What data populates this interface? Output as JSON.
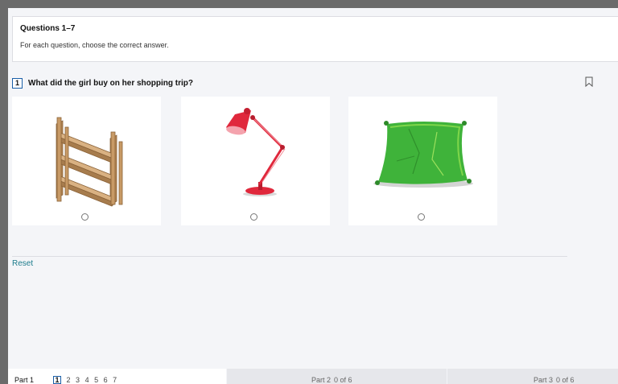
{
  "instructions": {
    "title": "Questions 1–7",
    "text": "For each question, choose the correct answer."
  },
  "question": {
    "number": "1",
    "text": "What did the girl buy on her shopping trip?",
    "options": [
      {
        "icon": "bookshelf-image"
      },
      {
        "icon": "desk-lamp-image"
      },
      {
        "icon": "green-cushion-image"
      }
    ]
  },
  "reset_label": "Reset",
  "footer": {
    "part1_label": "Part 1",
    "question_numbers": [
      "1",
      "2",
      "3",
      "4",
      "5",
      "6",
      "7"
    ],
    "current_question": "1",
    "part2_label": "Part 2",
    "part2_progress": "0 of 6",
    "part3_label": "Part 3",
    "part3_progress": "0 of 6"
  },
  "colors": {
    "accent": "#1a5fa8",
    "reset_link": "#1c7c8c",
    "lamp_red": "#e0283c",
    "cushion_green": "#3fb33a",
    "shelf_wood": "#c49a6c"
  }
}
